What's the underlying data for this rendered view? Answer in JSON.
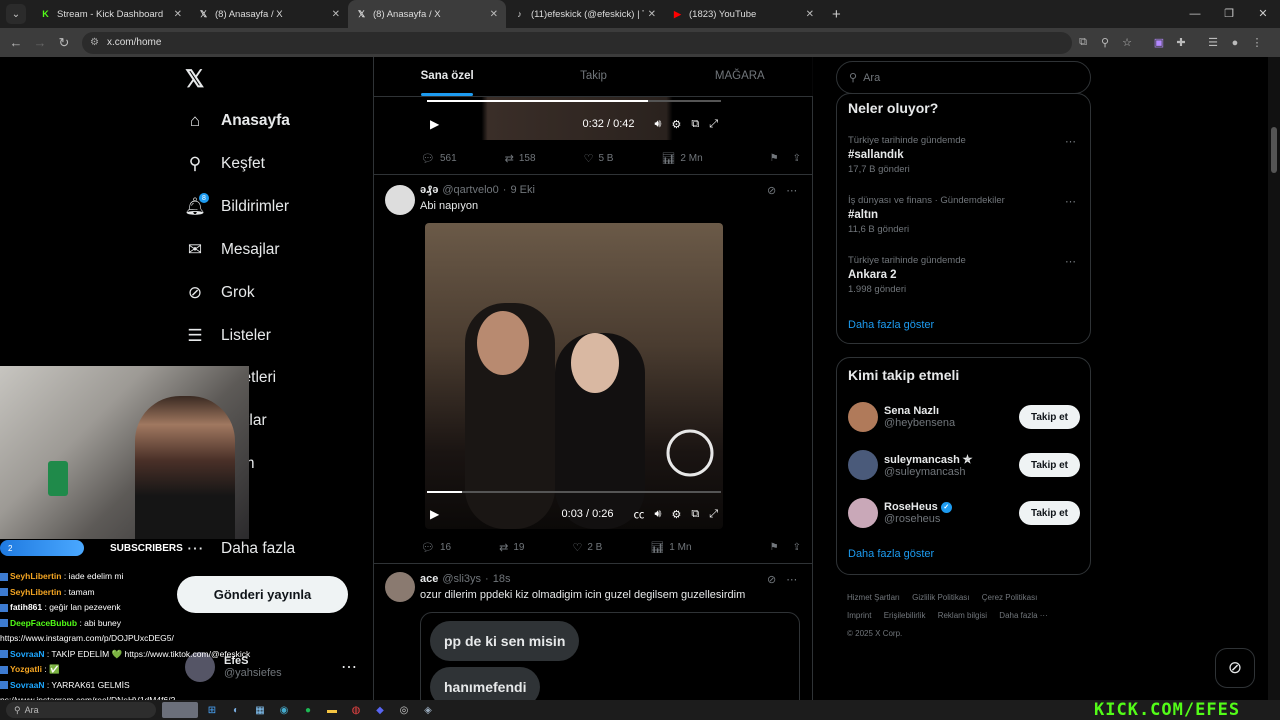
{
  "browser": {
    "tabs": [
      {
        "title": "Stream - Kick Dashboard",
        "favicon": "kick-icon",
        "color": "#53fc18"
      },
      {
        "title": "(8) Anasayfa / X",
        "favicon": "x-icon",
        "color": "#ffffff"
      },
      {
        "title": "(8) Anasayfa / X",
        "favicon": "x-icon",
        "color": "#ffffff"
      },
      {
        "title": "(11)efeskick (@efeskick) | TikTok",
        "favicon": "tiktok-icon",
        "color": "#ffffff"
      },
      {
        "title": "(1823) YouTube",
        "favicon": "youtube-icon",
        "color": "#ff0000"
      }
    ],
    "url": "x.com/home"
  },
  "nav": {
    "items": [
      {
        "label": "Anasayfa",
        "icon": "home-icon"
      },
      {
        "label": "Keşfet",
        "icon": "search-icon"
      },
      {
        "label": "Bildirimler",
        "icon": "bell-icon",
        "badge": "8"
      },
      {
        "label": "Mesajlar",
        "icon": "mail-icon"
      },
      {
        "label": "Grok",
        "icon": "grok-icon"
      },
      {
        "label": "Listeler",
        "icon": "list-icon"
      },
      {
        "label": "şaretleri",
        "icon": "bookmark-icon"
      },
      {
        "label": "uluklar",
        "icon": "communities-icon"
      },
      {
        "label": "nium",
        "icon": "premium-icon"
      },
      {
        "label": "il",
        "icon": "profile-icon"
      },
      {
        "label": "Daha fazla",
        "icon": "more-icon"
      }
    ],
    "post_button": "Gönderi yayınla",
    "profile": {
      "name": "EfeS",
      "handle": "@yahsiefes"
    }
  },
  "feed": {
    "tabs": [
      "Sana özel",
      "Takip",
      "MAĞARA"
    ],
    "tweets": [
      {
        "video_time": "0:32 / 0:42",
        "video_progress": 0.75,
        "stats": {
          "replies": "561",
          "retweets": "158",
          "likes": "5 B",
          "views": "2 Mn"
        }
      },
      {
        "name": "ə₰ə",
        "handle": "@qartvelo0",
        "time": "9 Eki",
        "text": "Abi napıyon",
        "video_time": "0:03 / 0:26",
        "video_progress": 0.12,
        "stats": {
          "replies": "16",
          "retweets": "19",
          "likes": "2 B",
          "views": "1 Mn"
        }
      },
      {
        "name": "ace",
        "handle": "@sli3ys",
        "time": "18s",
        "text": "ozur dilerim ppdeki kiz olmadigim icin guzel degilsem guzellesirdim",
        "chips": [
          "pp de ki sen misin",
          "hanımefendi"
        ]
      }
    ]
  },
  "sidebar": {
    "search_placeholder": "Ara",
    "trends_title": "Neler oluyor?",
    "trends": [
      {
        "meta": "Türkiye tarihinde gündemde",
        "name": "#sallandık",
        "count": "17,7 B gönderi"
      },
      {
        "meta": "İş dünyası ve finans · Gündemdekiler",
        "name": "#altın",
        "count": "11,6 B gönderi"
      },
      {
        "meta": "Türkiye tarihinde gündemde",
        "name": "Ankara 2",
        "count": "1.998 gönderi"
      }
    ],
    "trends_more": "Daha fazla göster",
    "follow_title": "Kimi takip etmeli",
    "follow": [
      {
        "name": "Sena Nazlı",
        "handle": "@heybensena",
        "button": "Takip et",
        "verified": false,
        "avatar_color": "#b07a5a"
      },
      {
        "name": "suleymancash ✯",
        "handle": "@suleymancash",
        "button": "Takip et",
        "verified": false,
        "avatar_color": "#4a5a7a"
      },
      {
        "name": "RoseHeus",
        "handle": "@roseheus",
        "button": "Takip et",
        "verified": true,
        "avatar_color": "#c9a8b8"
      }
    ],
    "follow_more": "Daha fazla göster",
    "footer": [
      "Hizmet Şartları",
      "Gizlilik Politikası",
      "Çerez Politikası",
      "Imprint",
      "Erişilebilirlik",
      "Reklam bilgisi",
      "Daha fazla ···",
      "© 2025 X Corp."
    ]
  },
  "overlay": {
    "subscribers_count": "2",
    "subscribers_label": "SUBSCRIBERS",
    "chat": [
      {
        "user": "SeyhLibertin",
        "msg": ": iade edelim mi",
        "color": "#f5a623"
      },
      {
        "user": "SeyhLibertin",
        "msg": ": tamam",
        "color": "#f5a623"
      },
      {
        "user": "fatih861",
        "msg": ": geğir lan pezevenk",
        "color": "#ffffff"
      },
      {
        "user": "DeepFaceBubub",
        "msg": ": abi buney",
        "color": "#53fc18"
      },
      {
        "user": "",
        "msg": "https://www.instagram.com/p/DOJPUxcDEG5/",
        "color": "#ffffff"
      },
      {
        "user": "SovraaN",
        "msg": ": TAKİP EDELİM 💚 https://www.tiktok.com/@efeskick",
        "color": "#1ea7ff"
      },
      {
        "user": "Yozgatli",
        "msg": ": ✅",
        "color": "#f5a623"
      },
      {
        "user": "SovraaN",
        "msg": ": YARRAK61 GELMİS",
        "color": "#1ea7ff"
      },
      {
        "user": "",
        "msg": "ps://www.instagram.com/reel/DNeHV1dM4f6/?",
        "color": "#ffffff"
      }
    ],
    "watermark": "KICK.COM/EFES"
  },
  "taskbar": {
    "search": "Ara"
  }
}
